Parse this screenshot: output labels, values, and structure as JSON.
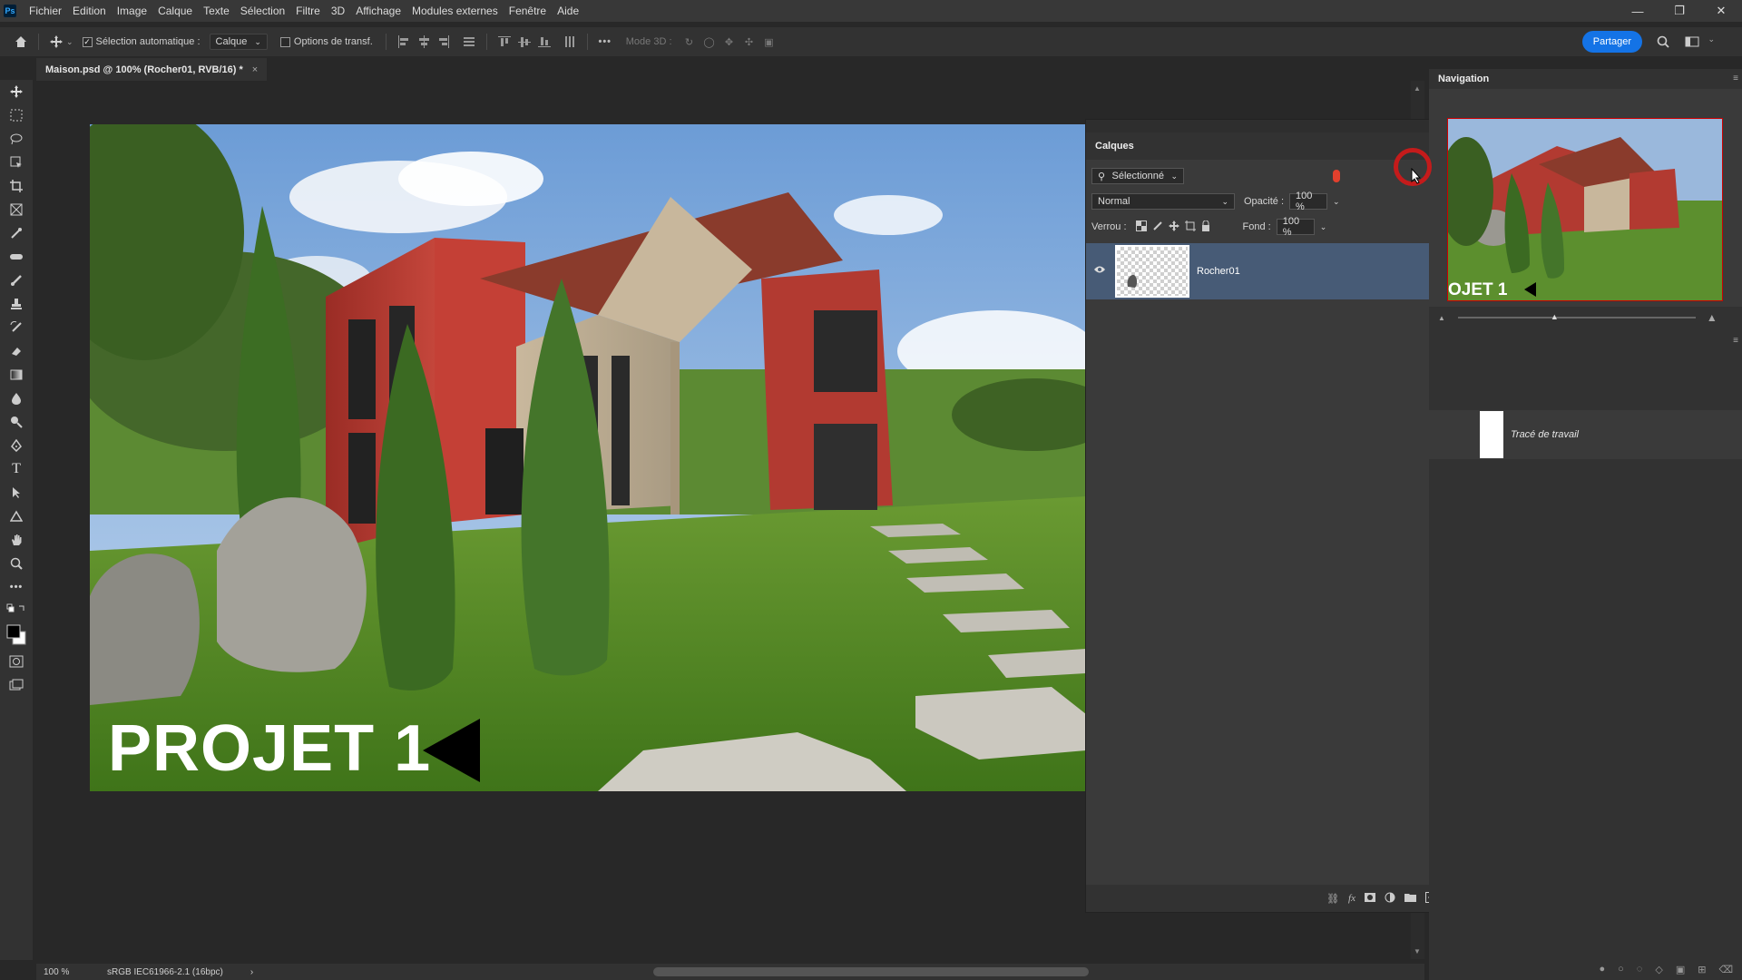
{
  "app": {
    "logo": "Ps"
  },
  "menu": [
    "Fichier",
    "Edition",
    "Image",
    "Calque",
    "Texte",
    "Sélection",
    "Filtre",
    "3D",
    "Affichage",
    "Modules externes",
    "Fenêtre",
    "Aide"
  ],
  "options": {
    "auto_select_label": "Sélection automatique :",
    "auto_select_value": "Calque",
    "transform_options_label": "Options de transf.",
    "mode3d_label": "Mode 3D :",
    "share_label": "Partager"
  },
  "document": {
    "tab_title": "Maison.psd @ 100% (Rocher01, RVB/16) *",
    "close": "×"
  },
  "canvas": {
    "overlay_text": "PROJET 1"
  },
  "status": {
    "zoom": "100 %",
    "profile": "sRGB IEC61966-2.1 (16bpc)",
    "arrow": "›"
  },
  "layers_panel": {
    "title": "Calques",
    "filter_value": "Sélectionné",
    "blend_mode": "Normal",
    "opacity_label": "Opacité :",
    "opacity_value": "100 %",
    "lock_label": "Verrou :",
    "fill_label": "Fond :",
    "fill_value": "100 %",
    "layers": [
      {
        "name": "Rocher01",
        "visible": true,
        "selected": true
      }
    ]
  },
  "navigation_panel": {
    "title": "Navigation",
    "thumb_text": "OJET 1"
  },
  "paths_panel": {
    "item": "Tracé de travail"
  },
  "colors": {
    "accent": "#1473e6",
    "selection": "#475b76",
    "wall_red": "#b93a30",
    "click_ring": "#c41b1b"
  }
}
